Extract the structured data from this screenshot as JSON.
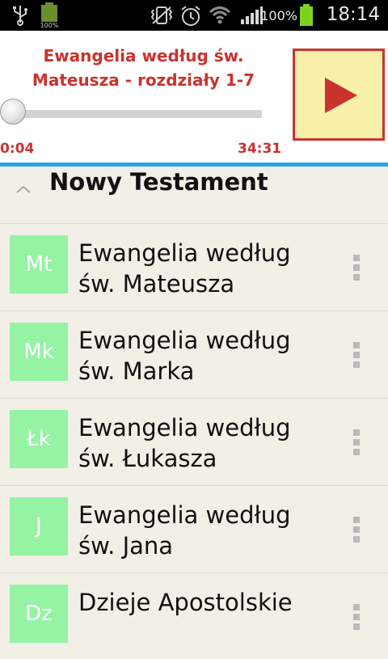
{
  "status_bar": {
    "time": "18:14",
    "battery_percent": "100%",
    "icons": [
      "usb-icon",
      "battery-small-icon",
      "vibrate-icon",
      "alarm-icon",
      "wifi-icon",
      "signal-icon",
      "battery-icon"
    ]
  },
  "player": {
    "track_title": "Ewangelia według św. Mateusza - rozdziały 1-7",
    "elapsed": "0:04",
    "total": "34:31",
    "progress_fraction": 0.002,
    "play_icon": "play-icon",
    "accent_color": "#c8332e",
    "button_bg": "#f8efa8"
  },
  "group": {
    "title": "Nowy Testament",
    "expanded": true
  },
  "books": [
    {
      "abbr": "Mt",
      "title": "Ewangelia według św. Mateusza"
    },
    {
      "abbr": "Mk",
      "title": "Ewangelia według św. Marka"
    },
    {
      "abbr": "Łk",
      "title": "Ewangelia według św. Łukasza"
    },
    {
      "abbr": "J",
      "title": "Ewangelia według św. Jana"
    },
    {
      "abbr": "Dz",
      "title": "Dzieje Apostolskie"
    }
  ],
  "colors": {
    "badge": "#95f3a4",
    "divider_blue": "#29a6e0",
    "list_bg": "#f2efe7"
  }
}
